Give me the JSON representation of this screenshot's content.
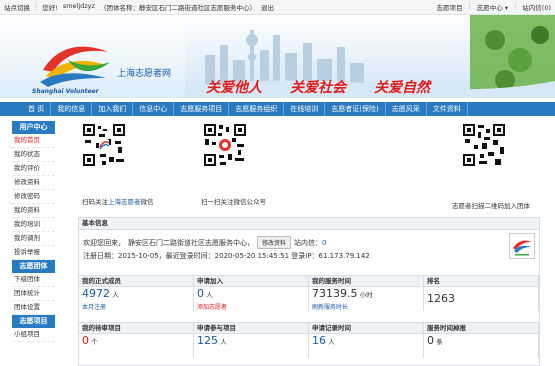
{
  "topbar": {
    "switch_site": "站点切换",
    "greeting": "您好!",
    "username": "smeljdzyz",
    "org": "（团体名称：静安区石门二路街道社区志愿服务中心）",
    "logout": "退出",
    "right_items": [
      "志愿项目",
      "志愿中心",
      "站内信"
    ]
  },
  "header": {
    "logo_cn": "上海志愿者网",
    "logo_en": "Shanghai Volunteer",
    "slogans": [
      "关爱他人",
      "关爱社会",
      "关爱自然"
    ]
  },
  "nav": [
    "首 页",
    "我的信息",
    "加入我们",
    "信息中心",
    "志愿服务项目",
    "志愿服务组织",
    "在线培训",
    "志愿者证(保险)",
    "志愿风采",
    "文件资料"
  ],
  "sidebar": {
    "sections": [
      {
        "title": "用户中心",
        "items": [
          "我的首页",
          "我的状态",
          "我的评价",
          "修改资料",
          "修改密码",
          "我的资料",
          "我的培训",
          "我的调剂",
          "投诉举报"
        ]
      },
      {
        "title": "志愿团体",
        "items": [
          "下级团体",
          "团体统计",
          "团体设置"
        ]
      },
      {
        "title": "志愿项目",
        "items": [
          "小组项目"
        ]
      }
    ],
    "active": "我的首页"
  },
  "qr": {
    "cap1_prefix": "扫码关注",
    "cap1_highlight": "上海志愿者",
    "cap1_suffix": "微信",
    "cap2": "扫一扫关注微信公众号",
    "cap3": "志愿者扫描二维码加入团体"
  },
  "panel": {
    "title": "基本信息",
    "welcome_prefix": "欢迎您回来，",
    "welcome_org": "静安区石门二路街道社区志愿服务中心，",
    "edit_button": "修改资料",
    "inbox_label": "站内信：",
    "inbox_count": "0",
    "reg_line": "注册日期：2015-10-05，最近登录时间：2020-05-20 15:45:51  登录IP：61.173.79.142"
  },
  "stats1": {
    "headers": [
      "我的正式成员",
      "申请加入",
      "我的服务时间",
      "排名"
    ],
    "values": [
      {
        "num": "4972",
        "unit": "人",
        "sub": "本月注册",
        "num_color": "blue",
        "sub_color": "blue"
      },
      {
        "num": "0",
        "unit": "人",
        "sub": "添加志愿者",
        "num_color": "blue",
        "sub_color": "red"
      },
      {
        "num": "73139.5",
        "unit": "小时",
        "sub": "刷新服务时长",
        "num_color": "black",
        "sub_color": "blue"
      },
      {
        "num": "1263",
        "unit": "",
        "sub": "",
        "num_color": "black",
        "sub_color": "blue"
      }
    ]
  },
  "stats2": {
    "headers": [
      "我的待审项目",
      "申请参与项目",
      "申请记录时间",
      "服务时间掉报"
    ],
    "values": [
      {
        "num": "0",
        "unit": "个",
        "num_color": "red"
      },
      {
        "num": "125",
        "unit": "人",
        "num_color": "blue"
      },
      {
        "num": "16",
        "unit": "人",
        "num_color": "blue"
      },
      {
        "num": "0",
        "unit": "条",
        "num_color": "black"
      }
    ]
  }
}
